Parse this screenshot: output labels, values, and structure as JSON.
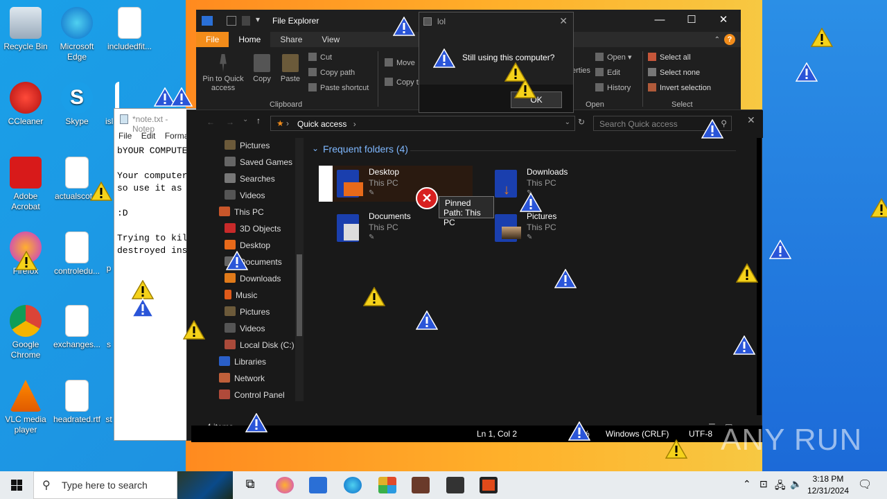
{
  "desktop": {
    "icons": [
      {
        "label": "Recycle Bin"
      },
      {
        "label": "Microsoft Edge"
      },
      {
        "label": "includedfit..."
      },
      {
        "label": "CCleaner"
      },
      {
        "label": "Skype"
      },
      {
        "label": "isl"
      },
      {
        "label": "Adobe Acrobat"
      },
      {
        "label": "actualscot..."
      },
      {
        "label": "Firefox"
      },
      {
        "label": "controledu..."
      },
      {
        "label": "p"
      },
      {
        "label": "Google Chrome"
      },
      {
        "label": "exchanges..."
      },
      {
        "label": "s"
      },
      {
        "label": "VLC media player"
      },
      {
        "label": "headrated.rtf"
      },
      {
        "label": "st"
      }
    ]
  },
  "notepad": {
    "title": "*note.txt - Notep",
    "menu": [
      "File",
      "Edit",
      "Format"
    ],
    "text": "bYOUR COMPUTER\n\nYour computer w\nso use it as lo\n\n:D\n\nTrying to kill\ndestroyed insta"
  },
  "explorer": {
    "title": "File Explorer",
    "tabs": [
      "File",
      "Home",
      "Share",
      "View"
    ],
    "ribbon": {
      "pin": "Pin to Quick access",
      "copy": "Copy",
      "paste": "Paste",
      "cut": "Cut",
      "copy_path": "Copy path",
      "paste_shortcut": "Paste shortcut",
      "move": "Move",
      "copy_to": "Copy t",
      "properties": "erties",
      "open": "Open",
      "edit": "Edit",
      "history": "History",
      "select_all": "Select all",
      "select_none": "Select none",
      "invert_selection": "Invert selection",
      "group_clipboard": "Clipboard",
      "group_open": "Open",
      "group_select": "Select"
    },
    "address": "Quick access",
    "search_placeholder": "Search Quick access",
    "nav": [
      {
        "label": "Pictures"
      },
      {
        "label": "Saved Games"
      },
      {
        "label": "Searches"
      },
      {
        "label": "Videos"
      },
      {
        "label": "This PC"
      },
      {
        "label": "3D Objects"
      },
      {
        "label": "Desktop"
      },
      {
        "label": "Documents"
      },
      {
        "label": "Downloads"
      },
      {
        "label": "Music"
      },
      {
        "label": "Pictures"
      },
      {
        "label": "Videos"
      },
      {
        "label": "Local Disk (C:)"
      },
      {
        "label": "Libraries"
      },
      {
        "label": "Network"
      },
      {
        "label": "Control Panel"
      }
    ],
    "section_header": "Frequent folders (4)",
    "folders": [
      {
        "name": "Desktop",
        "location": "This PC"
      },
      {
        "name": "Downloads",
        "location": "This PC"
      },
      {
        "name": "Documents",
        "location": "This PC"
      },
      {
        "name": "Pictures",
        "location": "This PC"
      }
    ],
    "tooltip_line1": "Pinned",
    "tooltip_line2": "Path: This PC",
    "status": "4 items"
  },
  "dialog": {
    "title": "lol",
    "message": "Still using this computer?",
    "ok_label": "OK"
  },
  "notepad_status": {
    "position": "Ln 1, Col 2",
    "zoom": "%",
    "line_endings": "Windows (CRLF)",
    "encoding": "UTF-8"
  },
  "taskbar": {
    "search_placeholder": "Type here to search",
    "time": "3:18 PM",
    "date": "12/31/2024"
  },
  "watermark": "ANY RUN",
  "colors": {
    "accent_orange": "#f28c1a",
    "folder_header": "#7fb8ff",
    "explorer_bg": "#191919"
  }
}
